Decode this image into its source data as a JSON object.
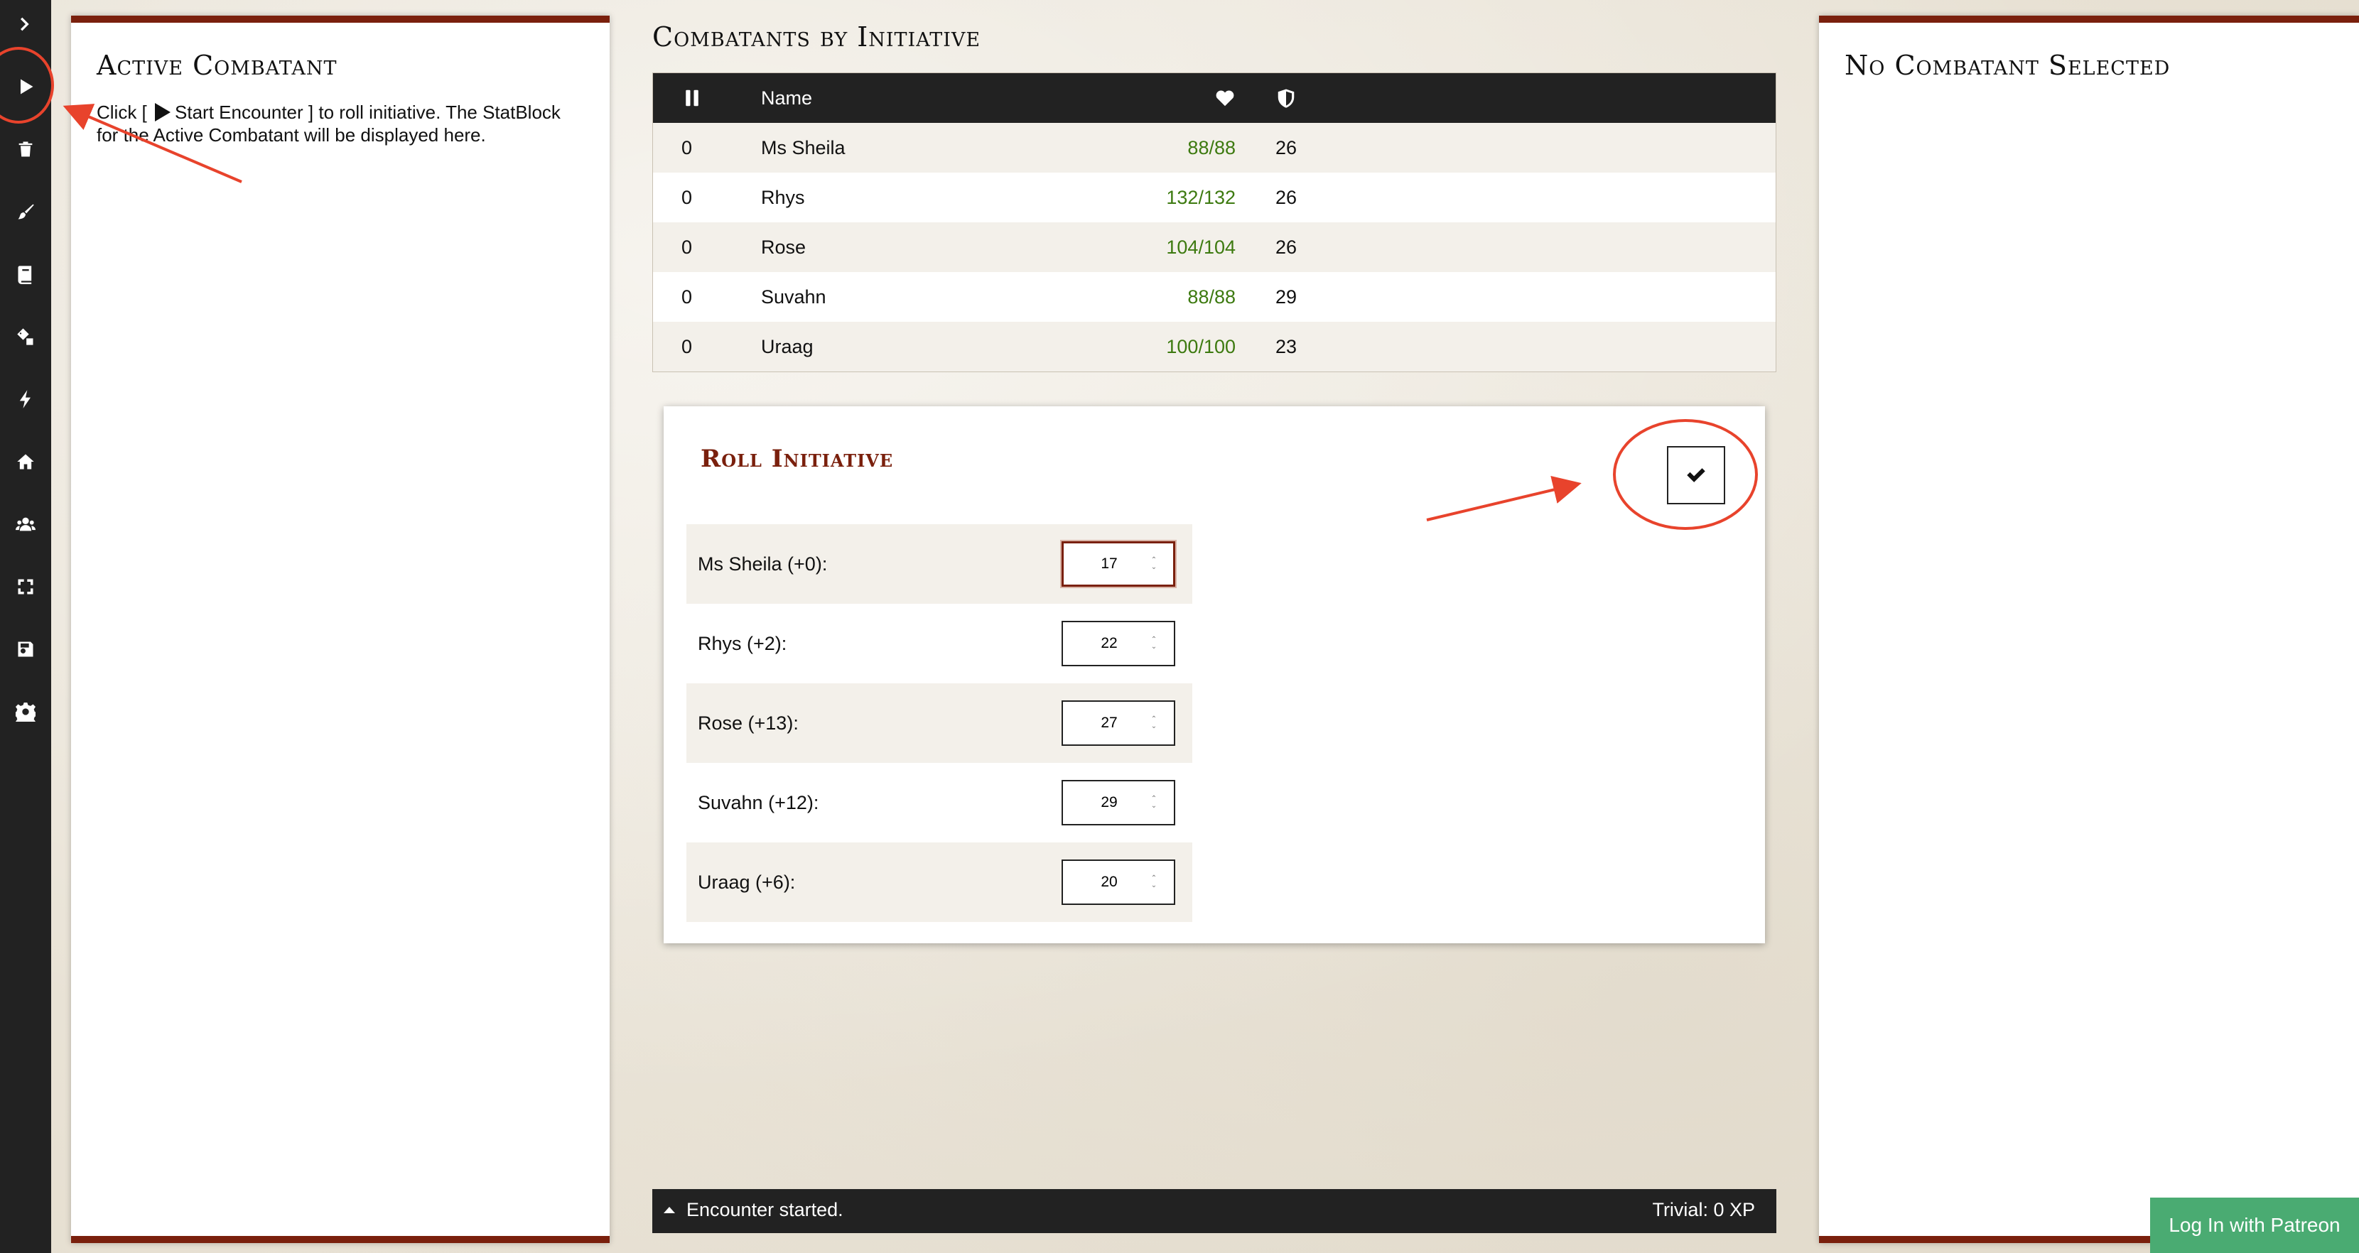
{
  "toolbar": {
    "items": [
      {
        "icon": "chevron-right-icon"
      },
      {
        "icon": "play-icon"
      },
      {
        "icon": "trash-icon"
      },
      {
        "icon": "brush-icon"
      },
      {
        "icon": "book-icon"
      },
      {
        "icon": "dice-icon"
      },
      {
        "icon": "bolt-icon"
      },
      {
        "icon": "home-icon"
      },
      {
        "icon": "users-icon"
      },
      {
        "icon": "fullscreen-icon"
      },
      {
        "icon": "save-icon"
      },
      {
        "icon": "gear-icon"
      }
    ]
  },
  "active_combatant": {
    "title": "Active Combatant",
    "instruction_prefix": "Click [",
    "instruction_button": "Start Encounter",
    "instruction_suffix": "] to roll initiative. The StatBlock for the Active Combatant will be displayed here."
  },
  "combatants": {
    "title": "Combatants by Initiative",
    "header": {
      "name": "Name"
    },
    "rows": [
      {
        "init": "0",
        "name": "Ms Sheila",
        "hp": "88/88",
        "ac": "26"
      },
      {
        "init": "0",
        "name": "Rhys",
        "hp": "132/132",
        "ac": "26"
      },
      {
        "init": "0",
        "name": "Rose",
        "hp": "104/104",
        "ac": "26"
      },
      {
        "init": "0",
        "name": "Suvahn",
        "hp": "88/88",
        "ac": "29"
      },
      {
        "init": "0",
        "name": "Uraag",
        "hp": "100/100",
        "ac": "23"
      }
    ]
  },
  "roll_initiative": {
    "title": "Roll Initiative",
    "rows": [
      {
        "label": "Ms Sheila (+0):",
        "value": "17"
      },
      {
        "label": "Rhys (+2):",
        "value": "22"
      },
      {
        "label": "Rose (+13):",
        "value": "27"
      },
      {
        "label": "Suvahn (+12):",
        "value": "29"
      },
      {
        "label": "Uraag (+6):",
        "value": "20"
      }
    ]
  },
  "status": {
    "message": "Encounter started.",
    "difficulty": "Trivial: 0 XP"
  },
  "selected_combatant": {
    "title": "No Combatant Selected"
  },
  "patreon": {
    "label": "Log In with Patreon"
  },
  "colors": {
    "accent": "#7a200d",
    "hp_green": "#3d7a10",
    "toolbar": "#222222",
    "annotation_red": "#e8432c",
    "patreon_green": "#4aab72"
  }
}
